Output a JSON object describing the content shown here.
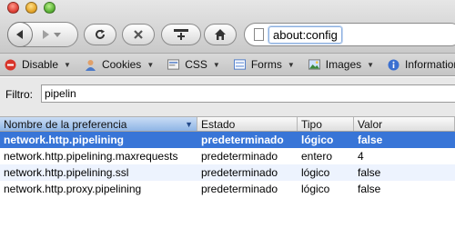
{
  "url": {
    "value": "about:config"
  },
  "devbar": {
    "items": [
      {
        "label": "Disable",
        "icon": "disable-icon"
      },
      {
        "label": "Cookies",
        "icon": "cookies-icon"
      },
      {
        "label": "CSS",
        "icon": "css-icon"
      },
      {
        "label": "Forms",
        "icon": "forms-icon"
      },
      {
        "label": "Images",
        "icon": "images-icon"
      },
      {
        "label": "Information",
        "icon": "information-icon"
      }
    ]
  },
  "filter": {
    "label": "Filtro:",
    "value": "pipelin"
  },
  "table": {
    "headers": [
      "Nombre de la preferencia",
      "Estado",
      "Tipo",
      "Valor"
    ],
    "rows": [
      {
        "name": "network.http.pipelining",
        "status": "predeterminado",
        "type": "lógico",
        "value": "false",
        "selected": true
      },
      {
        "name": "network.http.pipelining.maxrequests",
        "status": "predeterminado",
        "type": "entero",
        "value": "4"
      },
      {
        "name": "network.http.pipelining.ssl",
        "status": "predeterminado",
        "type": "lógico",
        "value": "false"
      },
      {
        "name": "network.http.proxy.pipelining",
        "status": "predeterminado",
        "type": "lógico",
        "value": "false"
      }
    ]
  },
  "colors": {
    "selection": "#3875d7",
    "alt_row": "#edf3fe"
  }
}
